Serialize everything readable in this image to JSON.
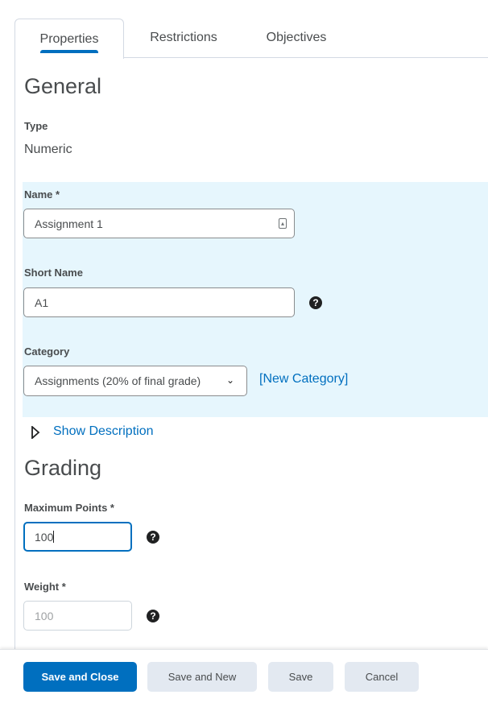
{
  "tabs": [
    {
      "label": "Properties",
      "active": true
    },
    {
      "label": "Restrictions",
      "active": false
    },
    {
      "label": "Objectives",
      "active": false
    }
  ],
  "general": {
    "heading": "General",
    "type_label": "Type",
    "type_value": "Numeric",
    "name_label": "Name *",
    "name_value": "Assignment 1",
    "short_name_label": "Short Name",
    "short_name_value": "A1",
    "category_label": "Category",
    "category_value": "Assignments (20% of final grade)",
    "new_category_link": "[New Category]",
    "show_description": "Show Description"
  },
  "grading": {
    "heading": "Grading",
    "max_points_label": "Maximum Points *",
    "max_points_value": "100",
    "weight_label": "Weight *",
    "weight_placeholder": "100"
  },
  "footer": {
    "save_close": "Save and Close",
    "save_new": "Save and New",
    "save": "Save",
    "cancel": "Cancel"
  },
  "colors": {
    "accent": "#006fbf",
    "highlight": "#e6f6fd"
  }
}
